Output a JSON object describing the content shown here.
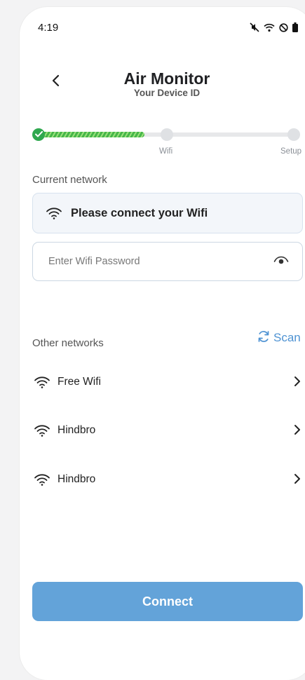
{
  "status_bar": {
    "time": "4:19",
    "icons": [
      "mute-icon",
      "wifi-icon",
      "dnd-icon",
      "battery-icon"
    ]
  },
  "header": {
    "title": "Air Monitor",
    "subtitle": "Your Device ID"
  },
  "progress": {
    "steps": [
      "Wifi",
      "Setup"
    ],
    "fraction_complete": 0.4,
    "colors": {
      "done": "#2fa84f",
      "fill": "#45b649",
      "track": "#e7e8ea"
    }
  },
  "current_network": {
    "label": "Current network",
    "status_text": "Please connect your Wifi"
  },
  "password": {
    "placeholder": "Enter Wifi Password",
    "value": ""
  },
  "other_networks": {
    "label": "Other networks",
    "scan_label": "Scan",
    "items": [
      {
        "name": "Free Wifi"
      },
      {
        "name": "Hindbro"
      },
      {
        "name": "Hindbro"
      }
    ]
  },
  "connect": {
    "label": "Connect",
    "color": "#63a3d9"
  }
}
